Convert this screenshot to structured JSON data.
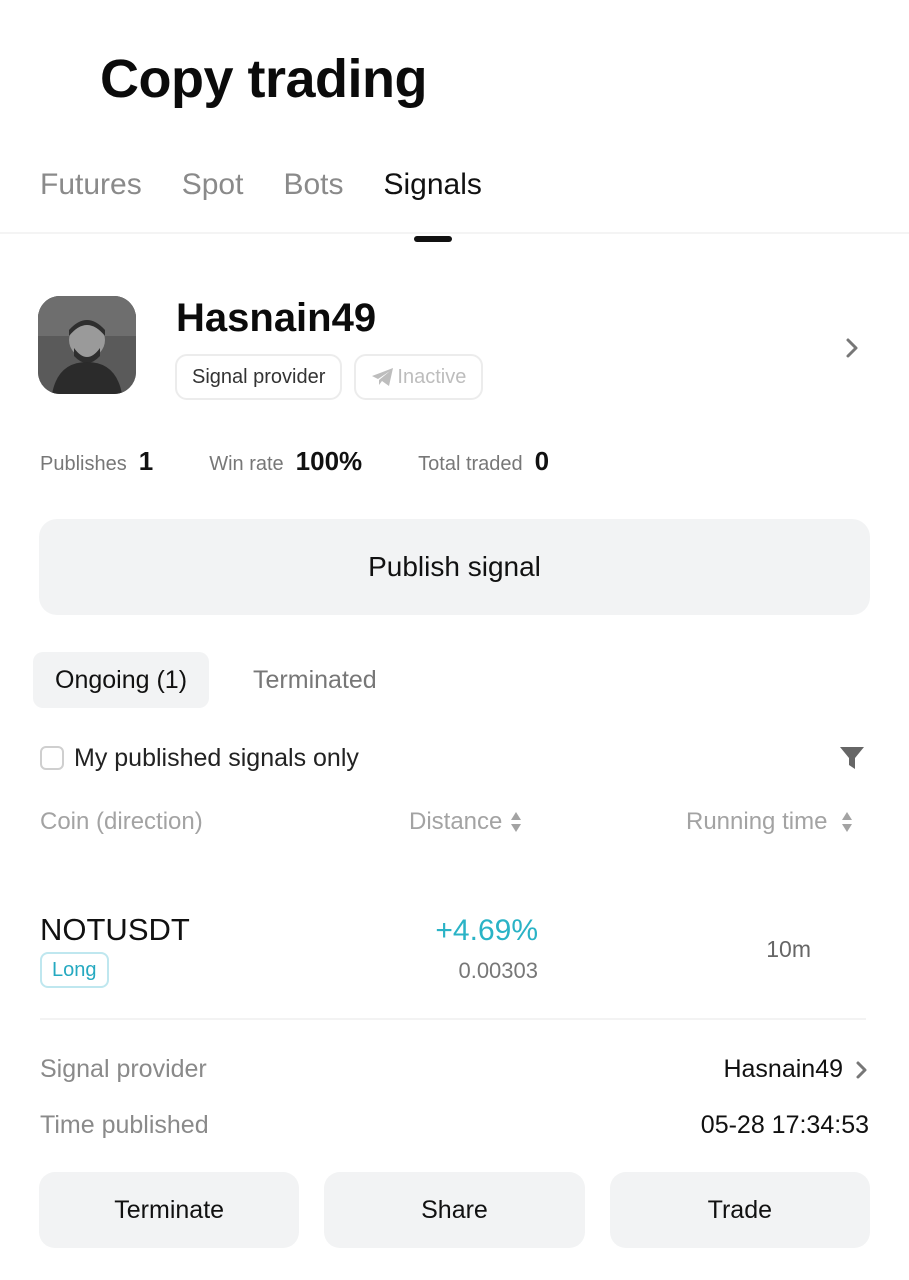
{
  "header": {
    "title": "Copy trading"
  },
  "tabs": [
    {
      "label": "Futures",
      "active": false
    },
    {
      "label": "Spot",
      "active": false
    },
    {
      "label": "Bots",
      "active": false
    },
    {
      "label": "Signals",
      "active": true
    }
  ],
  "profile": {
    "username": "Hasnain49",
    "role_chip": "Signal provider",
    "telegram_chip": "Inactive",
    "avatar_icon": "profile-photo",
    "chevron_icon": "chevron-right-icon"
  },
  "stats": [
    {
      "label": "Publishes",
      "value": "1"
    },
    {
      "label": "Win rate",
      "value": "100%"
    },
    {
      "label": "Total traded",
      "value": "0"
    }
  ],
  "publish_button": "Publish signal",
  "subtabs": [
    {
      "label": "Ongoing (1)",
      "active": true
    },
    {
      "label": "Terminated",
      "active": false
    }
  ],
  "filter": {
    "label": "My published signals only",
    "checked": false,
    "icon": "filter-icon"
  },
  "columns": {
    "coin": "Coin (direction)",
    "distance": "Distance",
    "running_time": "Running time"
  },
  "signal": {
    "coin": "NOTUSDT",
    "direction": "Long",
    "distance_pct": "+4.69%",
    "distance_value": "0.00303",
    "running_time": "10m"
  },
  "details": {
    "provider_label": "Signal provider",
    "provider_value": "Hasnain49",
    "time_label": "Time published",
    "time_value": "05-28 17:34:53"
  },
  "actions": {
    "terminate": "Terminate",
    "share": "Share",
    "trade": "Trade"
  },
  "colors": {
    "accent_teal": "#2ab3c6",
    "button_bg": "#f2f3f4",
    "muted_text": "#8a8a8a"
  }
}
